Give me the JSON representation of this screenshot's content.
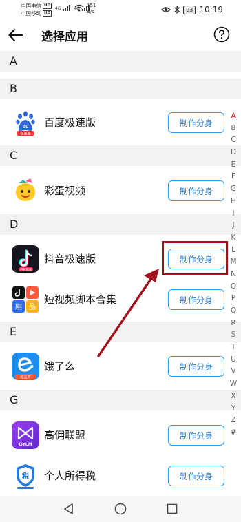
{
  "status_bar": {
    "carrier1": "中国电信",
    "carrier2": "中国移动",
    "hd_badge": "HD",
    "signal_label_1": "4G",
    "signal_label_2": "4G",
    "net_speed_value": "151",
    "net_speed_unit": "B/s",
    "battery": "93",
    "time": "10:19"
  },
  "header": {
    "title": "选择应用",
    "back_icon": "arrow-left-icon",
    "help_icon": "question-circle-icon"
  },
  "sections": [
    {
      "letter": "A",
      "apps": []
    },
    {
      "letter": "B",
      "apps": [
        {
          "name": "百度极速版",
          "button": "制作分身",
          "icon": "baidu-icon"
        }
      ]
    },
    {
      "letter": "C",
      "apps": [
        {
          "name": "彩蛋视频",
          "button": "制作分身",
          "icon": "caidan-icon"
        }
      ]
    },
    {
      "letter": "D",
      "apps": [
        {
          "name": "抖音极速版",
          "button": "制作分身",
          "icon": "douyin-icon"
        },
        {
          "name": "短视频脚本合集",
          "button": "制作分身",
          "icon": "script-collection-icon"
        }
      ]
    },
    {
      "letter": "E",
      "apps": [
        {
          "name": "饿了么",
          "button": "制作分身",
          "icon": "eleme-icon"
        }
      ]
    },
    {
      "letter": "G",
      "apps": [
        {
          "name": "高佣联盟",
          "button": "制作分身",
          "icon": "gylm-icon"
        },
        {
          "name": "个人所得税",
          "button": "制作分身",
          "icon": "tax-icon"
        }
      ]
    }
  ],
  "icon_text": {
    "baidu_badge": "极速版",
    "douyin_badge": "抖音极速",
    "eleme_badge": "超品节",
    "gylm_label": "GYLM",
    "tax_glyph": "税",
    "script_glyph_1": "剧",
    "script_glyph_2": "品"
  },
  "alphabet_index": [
    "A",
    "B",
    "C",
    "D",
    "E",
    "F",
    "G",
    "H",
    "I",
    "J",
    "K",
    "L",
    "M",
    "N",
    "O",
    "P",
    "Q",
    "R",
    "S",
    "T",
    "U",
    "V",
    "W",
    "X",
    "Y",
    "Z",
    "#"
  ],
  "alphabet_active": "A",
  "colors": {
    "accent": "#2a9be8",
    "annotation": "#a0121d",
    "index_active": "#e53935"
  }
}
